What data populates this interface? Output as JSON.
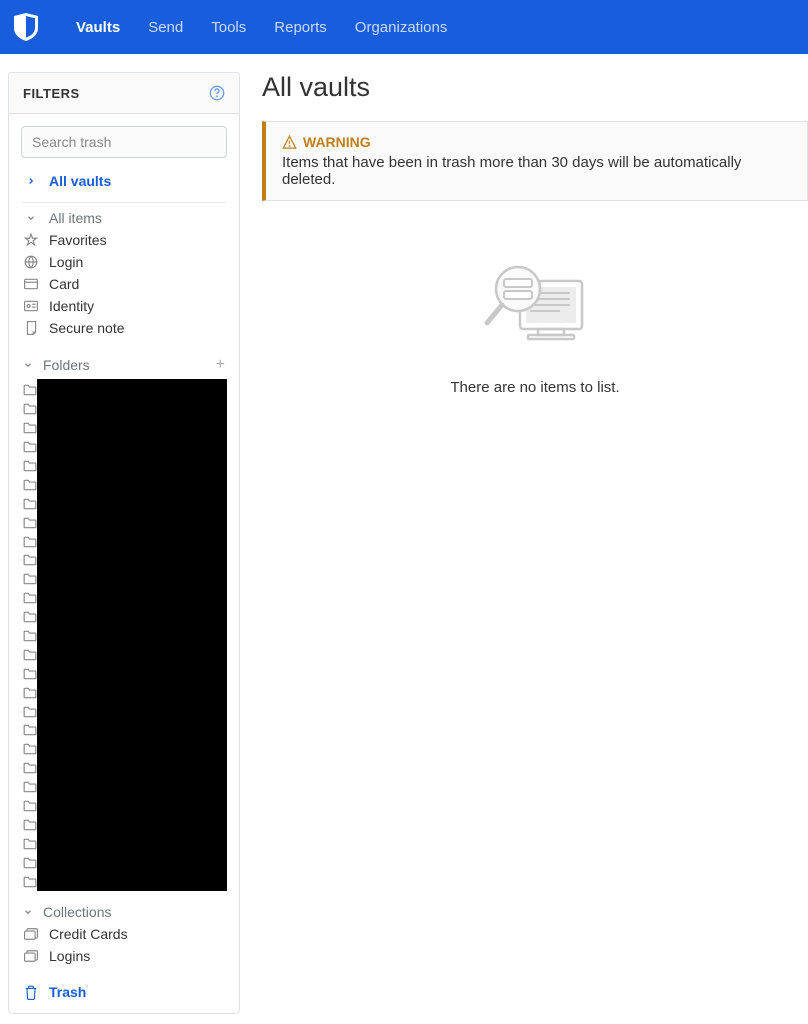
{
  "nav": {
    "items": [
      {
        "label": "Vaults",
        "active": true
      },
      {
        "label": "Send",
        "active": false
      },
      {
        "label": "Tools",
        "active": false
      },
      {
        "label": "Reports",
        "active": false
      },
      {
        "label": "Organizations",
        "active": false
      }
    ]
  },
  "sidebar": {
    "title": "FILTERS",
    "search_placeholder": "Search trash",
    "all_vaults": "All vaults",
    "types": [
      {
        "label": "All items",
        "icon": "chevron-down"
      },
      {
        "label": "Favorites",
        "icon": "star"
      },
      {
        "label": "Login",
        "icon": "globe"
      },
      {
        "label": "Card",
        "icon": "card"
      },
      {
        "label": "Identity",
        "icon": "id"
      },
      {
        "label": "Secure note",
        "icon": "note"
      }
    ],
    "folders_label": "Folders",
    "folder_count": 27,
    "collections": {
      "label": "Collections",
      "items": [
        {
          "label": "Credit Cards"
        },
        {
          "label": "Logins"
        }
      ]
    },
    "trash_label": "Trash"
  },
  "main": {
    "title": "All vaults",
    "warning": {
      "heading": "WARNING",
      "body": "Items that have been in trash more than 30 days will be automatically deleted."
    },
    "empty_text": "There are no items to list."
  }
}
